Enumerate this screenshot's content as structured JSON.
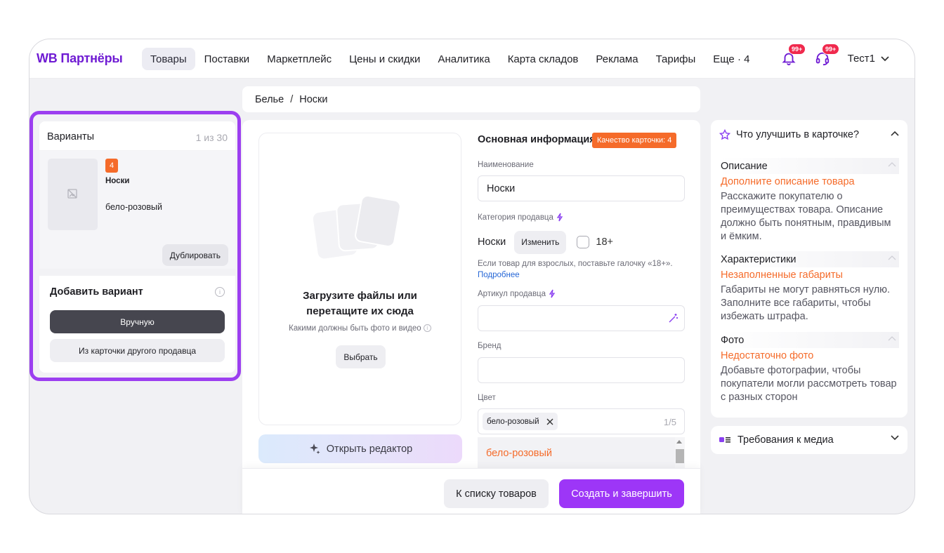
{
  "header": {
    "logo": "WB Партнёры",
    "nav": [
      "Товары",
      "Поставки",
      "Маркетплейс",
      "Цены и скидки",
      "Аналитика",
      "Карта складов",
      "Реклама",
      "Тарифы",
      "Еще · 4"
    ],
    "notifications_badge": "99+",
    "support_badge": "99+",
    "user": "Тест1"
  },
  "breadcrumb": {
    "parent": "Белье",
    "separator": "/",
    "current": "Носки"
  },
  "variants": {
    "title": "Варианты",
    "counter": "1 из 30",
    "item": {
      "quality": "4",
      "name": "Носки",
      "color": "бело-розовый"
    },
    "duplicate": "Дублировать",
    "add_title": "Добавить вариант",
    "manual": "Вручную",
    "from_other": "Из карточки другого продавца"
  },
  "upload": {
    "title": "Загрузите файлы или перетащите их сюда",
    "subtitle": "Какими должны быть фото и видео",
    "choose": "Выбрать",
    "editor": "Открыть редактор"
  },
  "form": {
    "section": "Основная информация",
    "quality_badge": "Качество карточки: 4",
    "name_label": "Наименование",
    "name_value": "Носки",
    "category_label": "Категория продавца",
    "category_value": "Носки",
    "change": "Изменить",
    "adult": "18+",
    "hint": "Если товар для взрослых, поставьте галочку «18+».",
    "hint_link": "Подробнее",
    "article_label": "Артикул продавца",
    "article_value": "",
    "brand_label": "Бренд",
    "brand_value": "",
    "color_label": "Цвет",
    "color_chip": "бело-розовый",
    "color_count": "1/5",
    "dropdown_option": "бело-розовый"
  },
  "footer": {
    "back": "К списку товаров",
    "create": "Создать и завершить"
  },
  "improve": {
    "title": "Что улучшить в карточке?",
    "sections": [
      {
        "title": "Описание",
        "warning": "Дополните описание товара",
        "text": "Расскажите покупателю о преимуществах товара. Описание должно быть понятным, правдивым и ёмким."
      },
      {
        "title": "Характеристики",
        "warning": "Незаполненные габариты",
        "text": "Габариты не могут равняться нулю. Заполните все габариты, чтобы избежать штрафа."
      },
      {
        "title": "Фото",
        "warning": "Недостаточно фото",
        "text": "Добавьте фотографии, чтобы покупатели могли рассмотреть товар с разных сторон"
      }
    ]
  },
  "media": {
    "title": "Требования к медиа"
  },
  "colors": {
    "brand": "#6f1bd3",
    "accent": "#9d36f7",
    "warning": "#f56b2a",
    "highlight": "#9c3ff0"
  }
}
